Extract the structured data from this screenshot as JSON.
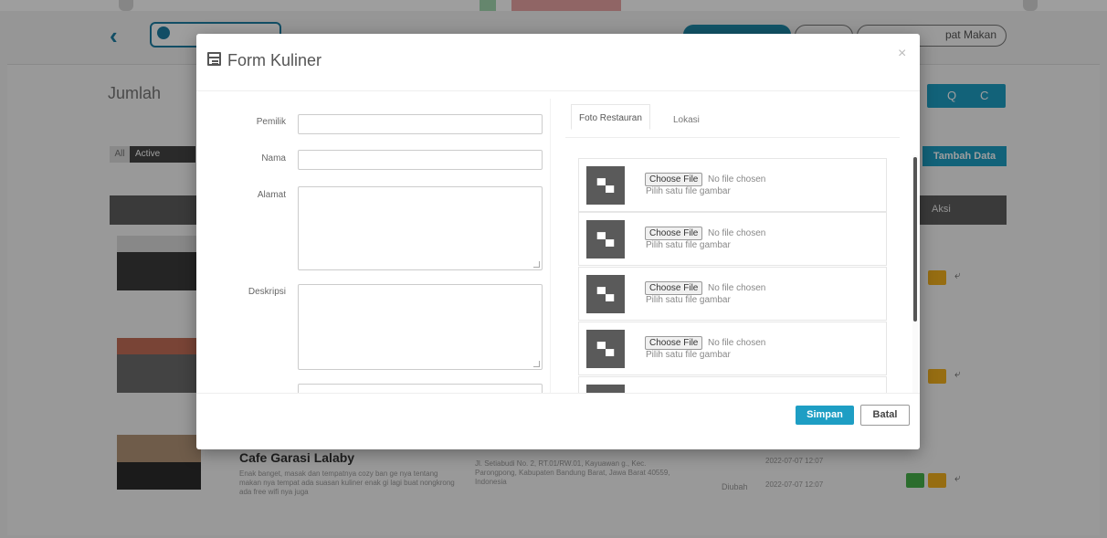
{
  "background": {
    "user_button_text": "",
    "pill_right_label": "pat Makan",
    "page_heading": "Jumlah",
    "filters": [
      "All",
      "Active"
    ],
    "search_icons": [
      "Q",
      "C"
    ],
    "add_button_label": "Tambah Data",
    "table_action_header": "Aksi",
    "visible_row": {
      "title": "Cafe Garasi Lalaby",
      "description": "Enak banget, masak dan tempatnya cozy ban ge nya tentang makan nya tempat ada suasan kuliner enak gi lagi buat nongkrong ada free wifi nya juga",
      "address": "Jl. Setiabudi No. 2, RT.01/RW.01, Kayuawan g., Kec. Parongpong, Kabupaten Bandung Barat, Jawa Barat 40559, Indonesia",
      "changed_label": "Diubah",
      "created_date": "2022-07-07 12:07",
      "changed_date": "2022-07-07 12:07"
    }
  },
  "modal": {
    "title": "Form Kuliner",
    "close_symbol": "×",
    "labels": {
      "owner": "Pemilik",
      "name": "Nama",
      "address": "Alamat",
      "description": "Deskripsi"
    },
    "tabs": [
      "Foto Restauran",
      "Lokasi"
    ],
    "file_inputs": [
      {
        "choose_label": "Choose File",
        "status": "No file chosen",
        "hint": "Pilih satu file gambar"
      },
      {
        "choose_label": "Choose File",
        "status": "No file chosen",
        "hint": "Pilih satu file gambar"
      },
      {
        "choose_label": "Choose File",
        "status": "No file chosen",
        "hint": "Pilih satu file gambar"
      },
      {
        "choose_label": "Choose File",
        "status": "No file chosen",
        "hint": "Pilih satu file gambar"
      }
    ],
    "footer": {
      "save_label": "Simpan",
      "cancel_label": "Batal"
    }
  },
  "icons": {
    "back": "chevron-left-icon",
    "form": "form-icon",
    "image_placeholder": "image-placeholder-icon",
    "search": "search-icon",
    "refresh": "refresh-icon"
  },
  "colors": {
    "primary": "#1e9ec4",
    "header_dark": "#5e5e5e",
    "edit_yellow": "#f2b01e",
    "view_green": "#46b04a"
  }
}
